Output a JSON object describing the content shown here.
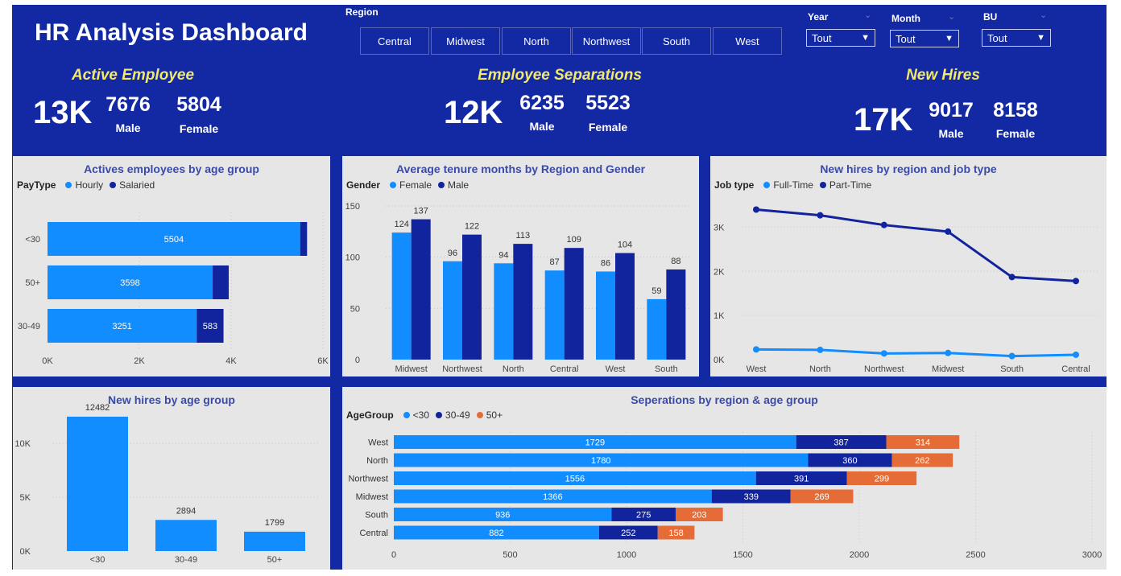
{
  "title": "HR Analysis Dashboard",
  "slicers": {
    "region_label": "Region",
    "regions": [
      "Central",
      "Midwest",
      "North",
      "Northwest",
      "South",
      "West"
    ],
    "dropdowns": [
      {
        "label": "Year",
        "value": "Tout"
      },
      {
        "label": "Month",
        "value": "Tout"
      },
      {
        "label": "BU",
        "value": "Tout"
      }
    ]
  },
  "kpis": [
    {
      "title": "Active Employee",
      "total": "13K",
      "male": "7676",
      "female": "5804",
      "male_label": "Male",
      "female_label": "Female"
    },
    {
      "title": "Employee Separations",
      "total": "12K",
      "male": "6235",
      "female": "5523",
      "male_label": "Male",
      "female_label": "Female"
    },
    {
      "title": "New Hires",
      "total": "17K",
      "male": "9017",
      "female": "8158",
      "male_label": "Male",
      "female_label": "Female"
    }
  ],
  "colors": {
    "light": "#118dff",
    "dark": "#12239e",
    "orange": "#e66c37",
    "frame": "#1328a3",
    "panel": "#e6e6e6",
    "title": "#3a4aa8",
    "kpi_title": "#f2e96b"
  },
  "chart_data": [
    {
      "type": "bar",
      "orientation": "horizontal",
      "stacked": true,
      "title": "Actives employees by age group",
      "legend_title": "PayType",
      "categories": [
        "<30",
        "50+",
        "30-49"
      ],
      "series": [
        {
          "name": "Hourly",
          "values": [
            5504,
            3598,
            3251
          ]
        },
        {
          "name": "Salaried",
          "values": [
            150,
            350,
            583
          ]
        }
      ],
      "data_labels": [
        [
          "5504",
          "3598",
          "3251"
        ],
        [
          "",
          "",
          "583"
        ]
      ],
      "xlim": [
        0,
        6000
      ],
      "x_ticks": [
        "0K",
        "2K",
        "4K",
        "6K"
      ]
    },
    {
      "type": "bar",
      "orientation": "vertical",
      "title": "Average tenure months by Region and Gender",
      "legend_title": "Gender",
      "categories": [
        "Midwest",
        "Northwest",
        "North",
        "Central",
        "West",
        "South"
      ],
      "series": [
        {
          "name": "Female",
          "values": [
            124,
            96,
            94,
            87,
            86,
            59
          ]
        },
        {
          "name": "Male",
          "values": [
            137,
            122,
            113,
            109,
            104,
            88
          ]
        }
      ],
      "ylim": [
        0,
        150
      ],
      "y_ticks": [
        "0",
        "50",
        "100",
        "150"
      ]
    },
    {
      "type": "line",
      "title": "New hires by region and job type",
      "legend_title": "Job type",
      "categories": [
        "West",
        "North",
        "Northwest",
        "Midwest",
        "South",
        "Central"
      ],
      "series": [
        {
          "name": "Full-Time",
          "values": [
            230,
            220,
            140,
            150,
            80,
            110
          ]
        },
        {
          "name": "Part-Time",
          "values": [
            3400,
            3270,
            3050,
            2900,
            1870,
            1780
          ]
        }
      ],
      "ylim": [
        0,
        3500
      ],
      "y_ticks": [
        "0K",
        "1K",
        "2K",
        "3K"
      ]
    },
    {
      "type": "bar",
      "orientation": "vertical",
      "title": "New hires by age group",
      "categories": [
        "<30",
        "30-49",
        "50+"
      ],
      "values": [
        12482,
        2894,
        1799
      ],
      "ylim": [
        0,
        13000
      ],
      "y_ticks": [
        "0K",
        "5K",
        "10K"
      ]
    },
    {
      "type": "bar",
      "orientation": "horizontal",
      "stacked": true,
      "title": "Seperations by region & age group",
      "legend_title": "AgeGroup",
      "categories": [
        "West",
        "North",
        "Northwest",
        "Midwest",
        "South",
        "Central"
      ],
      "series": [
        {
          "name": "<30",
          "values": [
            1729,
            1780,
            1556,
            1366,
            936,
            882
          ]
        },
        {
          "name": "30-49",
          "values": [
            387,
            360,
            391,
            339,
            275,
            252
          ]
        },
        {
          "name": "50+",
          "values": [
            314,
            262,
            299,
            269,
            203,
            158
          ]
        }
      ],
      "xlim": [
        0,
        3000
      ],
      "x_ticks": [
        "0",
        "500",
        "1000",
        "1500",
        "2000",
        "2500",
        "3000"
      ]
    }
  ]
}
